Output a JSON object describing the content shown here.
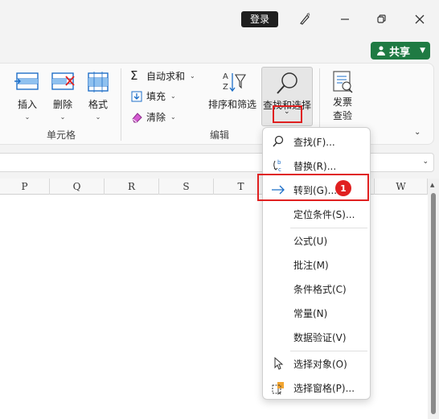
{
  "titlebar": {
    "login_label": "登录"
  },
  "share": {
    "label": "共享"
  },
  "ribbon": {
    "cells_group": {
      "label": "单元格",
      "insert_label": "插入",
      "delete_label": "删除",
      "format_label": "格式"
    },
    "edit_group": {
      "label": "编辑",
      "autosum_label": "自动求和",
      "fill_label": "填充",
      "clear_label": "清除",
      "sort_filter_label": "排序和筛选",
      "find_select_label": "查找和选择"
    },
    "invoice_group": {
      "line1": "发票",
      "line2": "查验"
    }
  },
  "sheet": {
    "columns": [
      "P",
      "Q",
      "R",
      "S",
      "T",
      "W"
    ]
  },
  "find_menu": {
    "items": [
      {
        "label": "查找(F)...",
        "icon": "search-icon"
      },
      {
        "label": "替换(R)...",
        "icon": "replace-icon"
      },
      {
        "label": "转到(G)...",
        "icon": "arrow-right-icon"
      },
      {
        "label": "定位条件(S)..."
      },
      {
        "label": "公式(U)"
      },
      {
        "label": "批注(M)"
      },
      {
        "label": "条件格式(C)"
      },
      {
        "label": "常量(N)"
      },
      {
        "label": "数据验证(V)"
      },
      {
        "label": "选择对象(O)",
        "icon": "cursor-icon"
      },
      {
        "label": "选择窗格(P)...",
        "icon": "selection-pane-icon"
      }
    ],
    "step_badge": "1"
  },
  "colors": {
    "accent_red": "#e02020",
    "share_green": "#1f7a43",
    "link_blue": "#1e6fc8"
  }
}
